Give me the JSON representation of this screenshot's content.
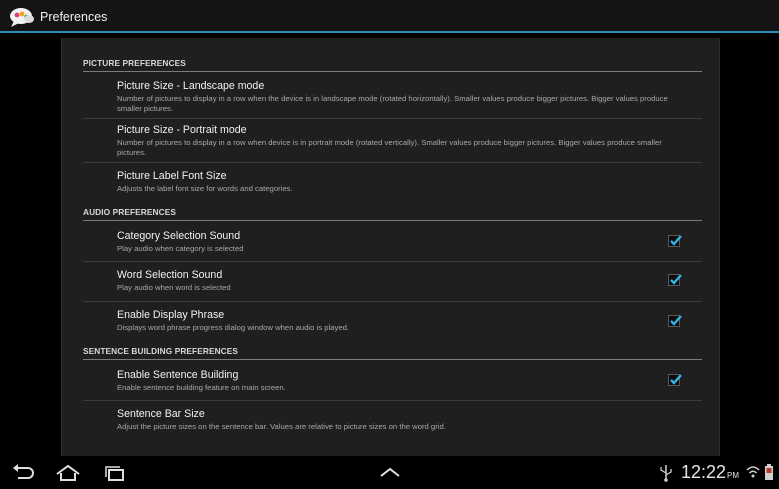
{
  "app": {
    "title": "Preferences",
    "icon": "speech-bubbles-icon"
  },
  "categories": [
    {
      "label": "PICTURE PREFERENCES"
    },
    {
      "label": "AUDIO PREFERENCES"
    },
    {
      "label": "SENTENCE BUILDING PREFERENCES"
    }
  ],
  "prefs": [
    {
      "title": "Picture Size - Landscape mode",
      "summary": "Number of pictures to display in a row when the device is in landscape mode (rotated horizontally). Smaller values produce bigger pictures. Bigger values produce smaller pictures."
    },
    {
      "title": "Picture Size - Portrait mode",
      "summary": "Number of pictures to display in a row when device is in portrait mode (rotated vertically). Smaller values produce bigger pictures. Bigger values produce smaller pictures."
    },
    {
      "title": "Picture Label Font Size",
      "summary": "Adjusts the label font size for words and categories."
    },
    {
      "title": "Category Selection Sound",
      "summary": "Play audio when category is selected",
      "checked": true
    },
    {
      "title": "Word Selection Sound",
      "summary": "Play audio when word is selected",
      "checked": true
    },
    {
      "title": "Enable Display Phrase",
      "summary": "Displays word phrase progress dialog window when audio is played.",
      "checked": true
    },
    {
      "title": "Enable Sentence Building",
      "summary": "Enable sentence building feature on main screen.",
      "checked": true
    },
    {
      "title": "Sentence Bar Size",
      "summary": "Adjust the picture sizes on the sentence bar. Values are relative to picture sizes on the word grid."
    }
  ],
  "statusbar": {
    "time": "12:22",
    "ampm": "PM",
    "icons": [
      "usb-icon",
      "wifi-icon",
      "battery-icon"
    ]
  },
  "navbar": {
    "icons": [
      "back-icon",
      "home-icon",
      "recent-apps-icon",
      "up-chevron-icon"
    ]
  },
  "colors": {
    "accent": "#2a8fbd",
    "checkmark": "#33b5e5",
    "panel": "#1f1f1f"
  }
}
